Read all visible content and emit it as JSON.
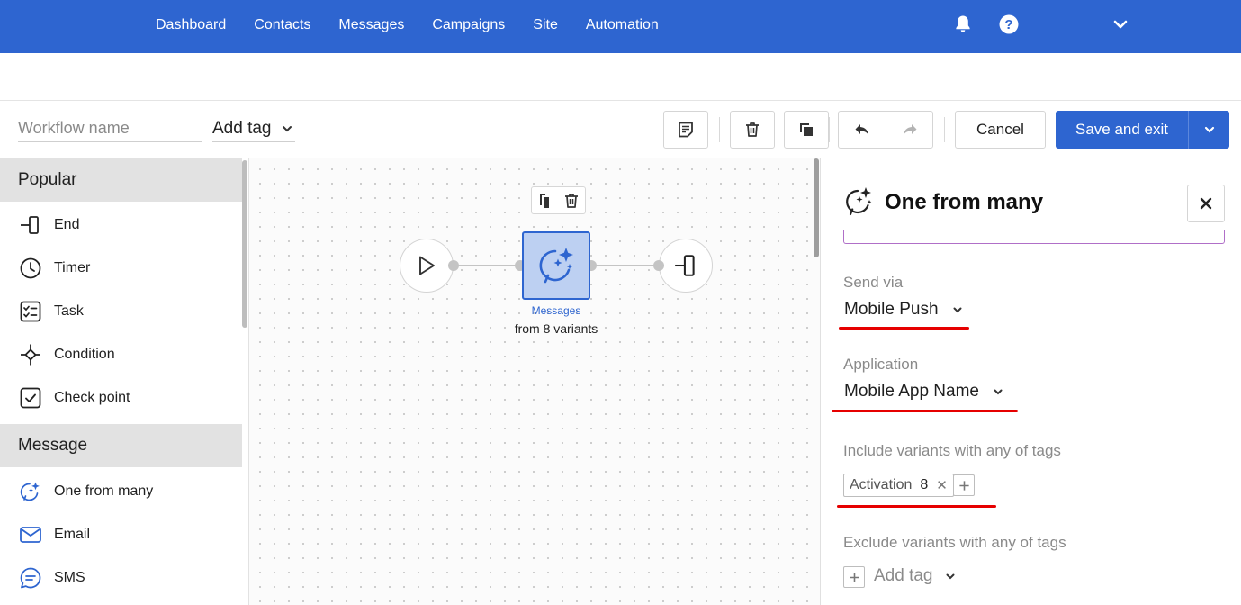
{
  "nav": {
    "links": [
      "Dashboard",
      "Contacts",
      "Messages",
      "Campaigns",
      "Site",
      "Automation"
    ],
    "icons": [
      "bell-icon",
      "help-icon",
      "chevron-down-icon"
    ]
  },
  "toolbar": {
    "workflow_name_placeholder": "Workflow name",
    "add_tag": "Add tag",
    "cancel": "Cancel",
    "save": "Save and exit"
  },
  "sidebar": {
    "sections": [
      {
        "title": "Popular",
        "items": [
          "End",
          "Timer",
          "Task",
          "Condition",
          "Check point"
        ]
      },
      {
        "title": "Message",
        "items": [
          "One from many",
          "Email",
          "SMS"
        ]
      }
    ]
  },
  "canvas": {
    "node_label_1": "Messages",
    "node_label_2": "from 8 variants"
  },
  "panel": {
    "title": "One from many",
    "send_via_label": "Send via",
    "send_via_value": "Mobile Push",
    "application_label": "Application",
    "application_value": "Mobile App Name",
    "include_label": "Include variants with any of tags",
    "include_tag": {
      "name": "Activation",
      "count": "8"
    },
    "exclude_label": "Exclude variants with any of tags",
    "exclude_add_tag": "Add tag"
  },
  "colors": {
    "brand": "#2e65d0",
    "annotation_red": "#e60000",
    "node_fill": "#bdd0f2"
  }
}
